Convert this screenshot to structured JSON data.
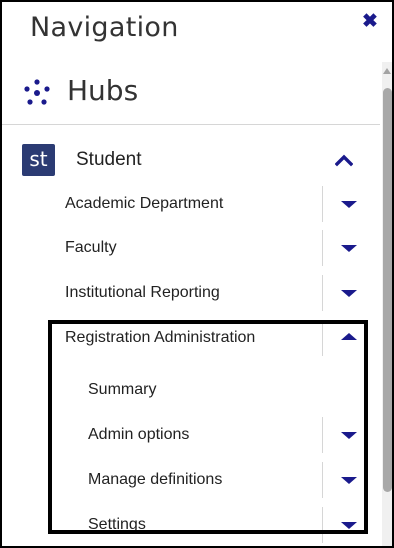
{
  "header": {
    "title": "Navigation",
    "close_glyph": "✖"
  },
  "hubs": {
    "label": "Hubs",
    "icon": "hubs-network-icon"
  },
  "student": {
    "badge": "st",
    "label": "Student",
    "expanded": true
  },
  "menu": [
    {
      "label": "Academic Department",
      "state": "collapsed"
    },
    {
      "label": "Faculty",
      "state": "collapsed"
    },
    {
      "label": "Institutional Reporting",
      "state": "collapsed"
    },
    {
      "label": "Registration Administration",
      "state": "expanded"
    }
  ],
  "submenu": [
    {
      "label": "Summary",
      "has_toggle": false
    },
    {
      "label": "Admin options",
      "state": "collapsed",
      "has_toggle": true
    },
    {
      "label": "Manage definitions",
      "state": "collapsed",
      "has_toggle": true
    },
    {
      "label": "Settings",
      "state": "collapsed",
      "has_toggle": true
    }
  ],
  "colors": {
    "accent": "#1a1a8c",
    "badge_bg": "#2b3b73",
    "divider": "#d6d6d6"
  }
}
